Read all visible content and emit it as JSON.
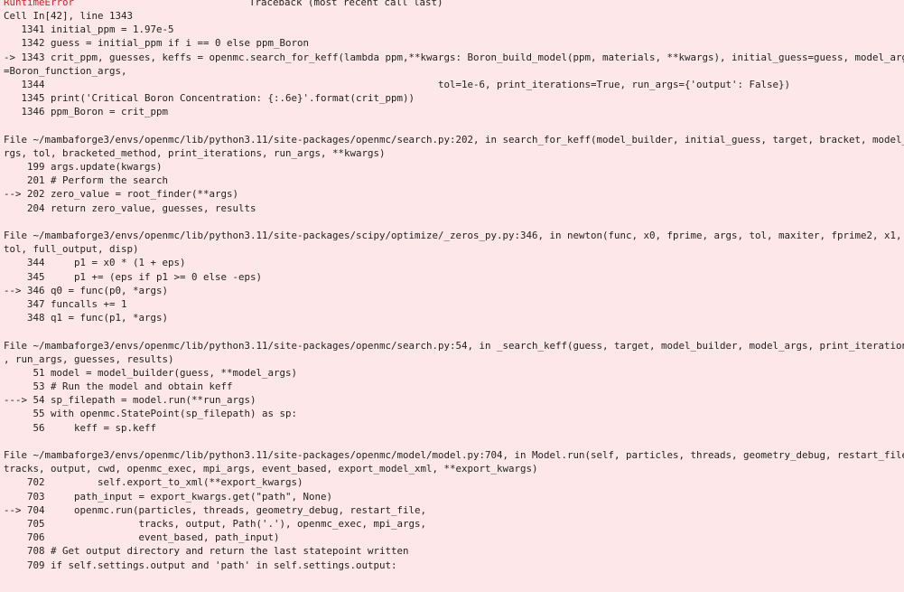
{
  "header": {
    "error_name": "RuntimeError",
    "traceback_title": "Traceback (most recent call last)"
  },
  "frames": [
    {
      "lines": [
        {
          "t": "Cell In[42], line 1343"
        },
        {
          "t": "   1341 initial_ppm = 1.97e-5"
        },
        {
          "t": "   1342 guess = initial_ppm if i == 0 else ppm_Boron"
        },
        {
          "t": "-> 1343 crit_ppm, guesses, keffs = openmc.search_for_keff(lambda ppm,**kwargs: Boron_build_model(ppm, materials, **kwargs), initial_guess=guess, model_args"
        },
        {
          "t": "=Boron_function_args,"
        },
        {
          "t": "   1344                                                                   tol=1e-6, print_iterations=True, run_args={'output': False})"
        },
        {
          "t": "   1345 print('Critical Boron Concentration: {:.6e}'.format(crit_ppm))"
        },
        {
          "t": "   1346 ppm_Boron = crit_ppm"
        }
      ]
    },
    {
      "lines": [
        {
          "t": "File ~/mambaforge3/envs/openmc/lib/python3.11/site-packages/openmc/search.py:202, in search_for_keff(model_builder, initial_guess, target, bracket, model_a"
        },
        {
          "t": "rgs, tol, bracketed_method, print_iterations, run_args, **kwargs)"
        },
        {
          "t": "    199 args.update(kwargs)"
        },
        {
          "t": "    201 # Perform the search"
        },
        {
          "t": "--> 202 zero_value = root_finder(**args)"
        },
        {
          "t": "    204 return zero_value, guesses, results"
        }
      ]
    },
    {
      "lines": [
        {
          "t": "File ~/mambaforge3/envs/openmc/lib/python3.11/site-packages/scipy/optimize/_zeros_py.py:346, in newton(func, x0, fprime, args, tol, maxiter, fprime2, x1, r"
        },
        {
          "t": "tol, full_output, disp)"
        },
        {
          "t": "    344     p1 = x0 * (1 + eps)"
        },
        {
          "t": "    345     p1 += (eps if p1 >= 0 else -eps)"
        },
        {
          "t": "--> 346 q0 = func(p0, *args)"
        },
        {
          "t": "    347 funcalls += 1"
        },
        {
          "t": "    348 q1 = func(p1, *args)"
        }
      ]
    },
    {
      "lines": [
        {
          "t": "File ~/mambaforge3/envs/openmc/lib/python3.11/site-packages/openmc/search.py:54, in _search_keff(guess, target, model_builder, model_args, print_iterations"
        },
        {
          "t": ", run_args, guesses, results)"
        },
        {
          "t": "     51 model = model_builder(guess, **model_args)"
        },
        {
          "t": "     53 # Run the model and obtain keff"
        },
        {
          "t": "---> 54 sp_filepath = model.run(**run_args)"
        },
        {
          "t": "     55 with openmc.StatePoint(sp_filepath) as sp:"
        },
        {
          "t": "     56     keff = sp.keff"
        }
      ]
    },
    {
      "lines": [
        {
          "t": "File ~/mambaforge3/envs/openmc/lib/python3.11/site-packages/openmc/model/model.py:704, in Model.run(self, particles, threads, geometry_debug, restart_file,"
        },
        {
          "t": "tracks, output, cwd, openmc_exec, mpi_args, event_based, export_model_xml, **export_kwargs)"
        },
        {
          "t": "    702         self.export_to_xml(**export_kwargs)"
        },
        {
          "t": "    703     path_input = export_kwargs.get(\"path\", None)"
        },
        {
          "t": "--> 704     openmc.run(particles, threads, geometry_debug, restart_file,"
        },
        {
          "t": "    705                tracks, output, Path('.'), openmc_exec, mpi_args,"
        },
        {
          "t": "    706                event_based, path_input)"
        },
        {
          "t": "    708 # Get output directory and return the last statepoint written"
        },
        {
          "t": "    709 if self.settings.output and 'path' in self.settings.output:"
        }
      ]
    }
  ]
}
